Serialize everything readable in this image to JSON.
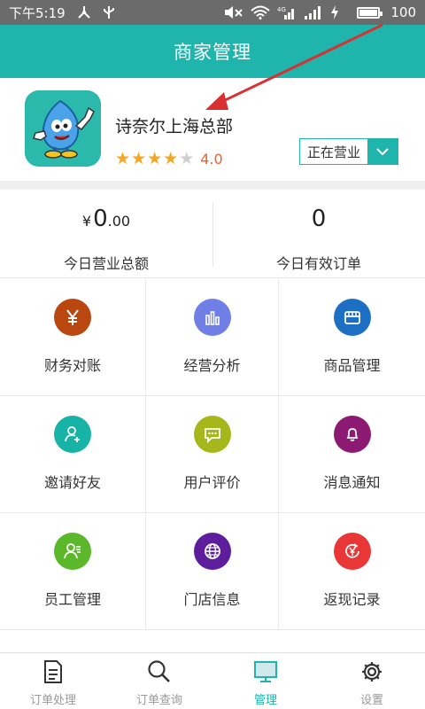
{
  "status_bar": {
    "time": "下午5:19",
    "battery": "100"
  },
  "header": {
    "title": "商家管理"
  },
  "shop": {
    "name": "诗奈尔上海总部",
    "rating_value": "4.0",
    "stars_filled": 4,
    "stars_total": 5,
    "status_label": "正在营业"
  },
  "stats": {
    "revenue": {
      "currency": "¥",
      "integer": "0",
      "decimal": ".00",
      "label": "今日营业总额"
    },
    "orders": {
      "value": "0",
      "label": "今日有效订单"
    }
  },
  "menu": [
    {
      "label": "财务对账",
      "icon": "yuan-icon",
      "color": "#b9470f"
    },
    {
      "label": "经营分析",
      "icon": "bar-chart-icon",
      "color": "#6f7fe6"
    },
    {
      "label": "商品管理",
      "icon": "product-icon",
      "color": "#1d6fc4"
    },
    {
      "label": "邀请好友",
      "icon": "invite-user-icon",
      "color": "#17b3a6"
    },
    {
      "label": "用户评价",
      "icon": "comment-icon",
      "color": "#a5b71b"
    },
    {
      "label": "消息通知",
      "icon": "bell-icon",
      "color": "#8c1a72"
    },
    {
      "label": "员工管理",
      "icon": "staff-icon",
      "color": "#5cb82b"
    },
    {
      "label": "门店信息",
      "icon": "globe-icon",
      "color": "#5d1d9c"
    },
    {
      "label": "返现记录",
      "icon": "cashback-icon",
      "color": "#e93737"
    }
  ],
  "tabs": [
    {
      "label": "订单处理",
      "icon": "document-icon",
      "active": false
    },
    {
      "label": "订单查询",
      "icon": "search-icon",
      "active": false
    },
    {
      "label": "管理",
      "icon": "monitor-icon",
      "active": true
    },
    {
      "label": "设置",
      "icon": "gear-icon",
      "active": false
    }
  ],
  "colors": {
    "brand": "#1fb5ad",
    "rating": "#e8632b",
    "star": "#f5a623"
  }
}
